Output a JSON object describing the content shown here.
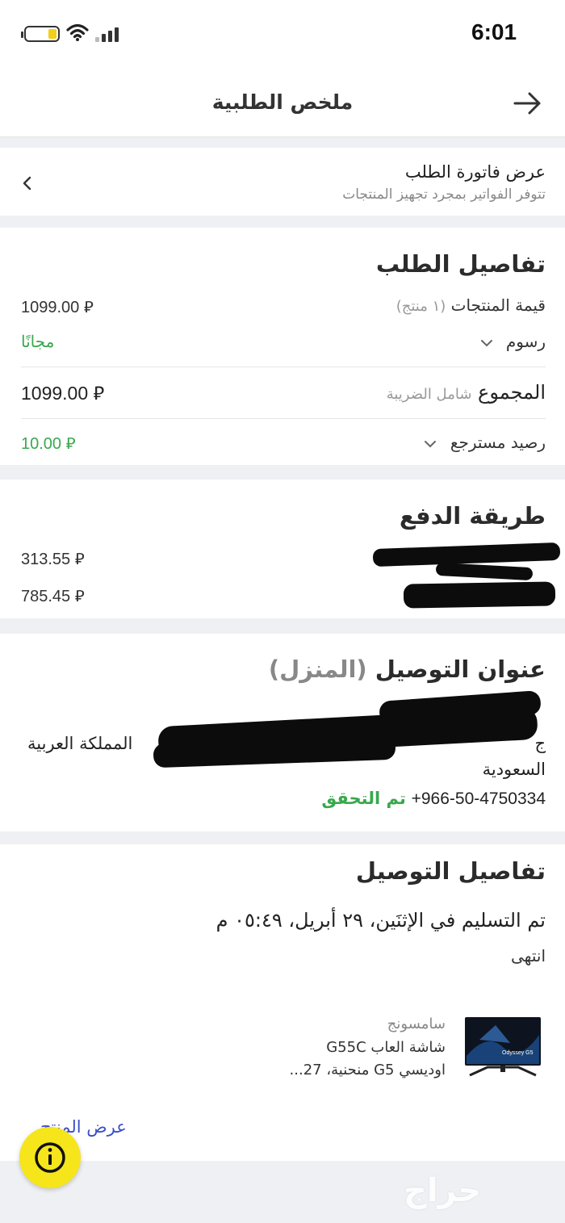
{
  "status_bar": {
    "time": "6:01"
  },
  "header": {
    "title": "ملخص الطلبية"
  },
  "invoice": {
    "title": "عرض فاتورة الطلب",
    "subtitle": "تتوفر الفواتير بمجرد تجهيز المنتجات"
  },
  "order_details": {
    "title": "تفاصيل الطلب",
    "products_label": "قيمة المنتجات",
    "products_count": "(١ منتج)",
    "products_value": "1099.00 ⃁",
    "fees_label": "رسوم",
    "fees_value": "مجانًا",
    "total_label": "المجموع",
    "total_note": "شامل الضريبة",
    "total_value": "1099.00 ⃁",
    "refund_label": "رصيد مسترجع",
    "refund_value": "10.00 ⃁"
  },
  "payment": {
    "title": "طريقة الدفع",
    "amount1": "313.55 ⃁",
    "amount2": "785.45 ⃁"
  },
  "address": {
    "title": "عنوان التوصيل",
    "type": "(المنزل)",
    "line_country": "المملكة العربية",
    "line_fragment": "ج",
    "line2": "السعودية",
    "phone": "+966-50-4750334",
    "verified": "تم التحقق"
  },
  "delivery": {
    "title": "تفاصيل التوصيل",
    "delivered_text": "تم التسليم في الإثنَين، ٢٩ أبريل، ٠٥:٤٩ م",
    "status": "انتهى",
    "product": {
      "brand": "سامسونج",
      "name_line1": "شاشة العاب G55C",
      "name_line2": "اوديسي G5 منحنية، 27...",
      "image_label": "Odyssey G5"
    },
    "view_product": "عرض المنتج"
  },
  "colors": {
    "accent_green": "#3aa84e",
    "link_blue": "#3b50c9",
    "fab_yellow": "#f6e51a"
  },
  "icons": [
    "battery-icon",
    "wifi-icon",
    "signal-icon",
    "arrow-right-icon",
    "chevron-left-icon",
    "chevron-down-icon",
    "info-icon"
  ],
  "watermark": "حراج"
}
